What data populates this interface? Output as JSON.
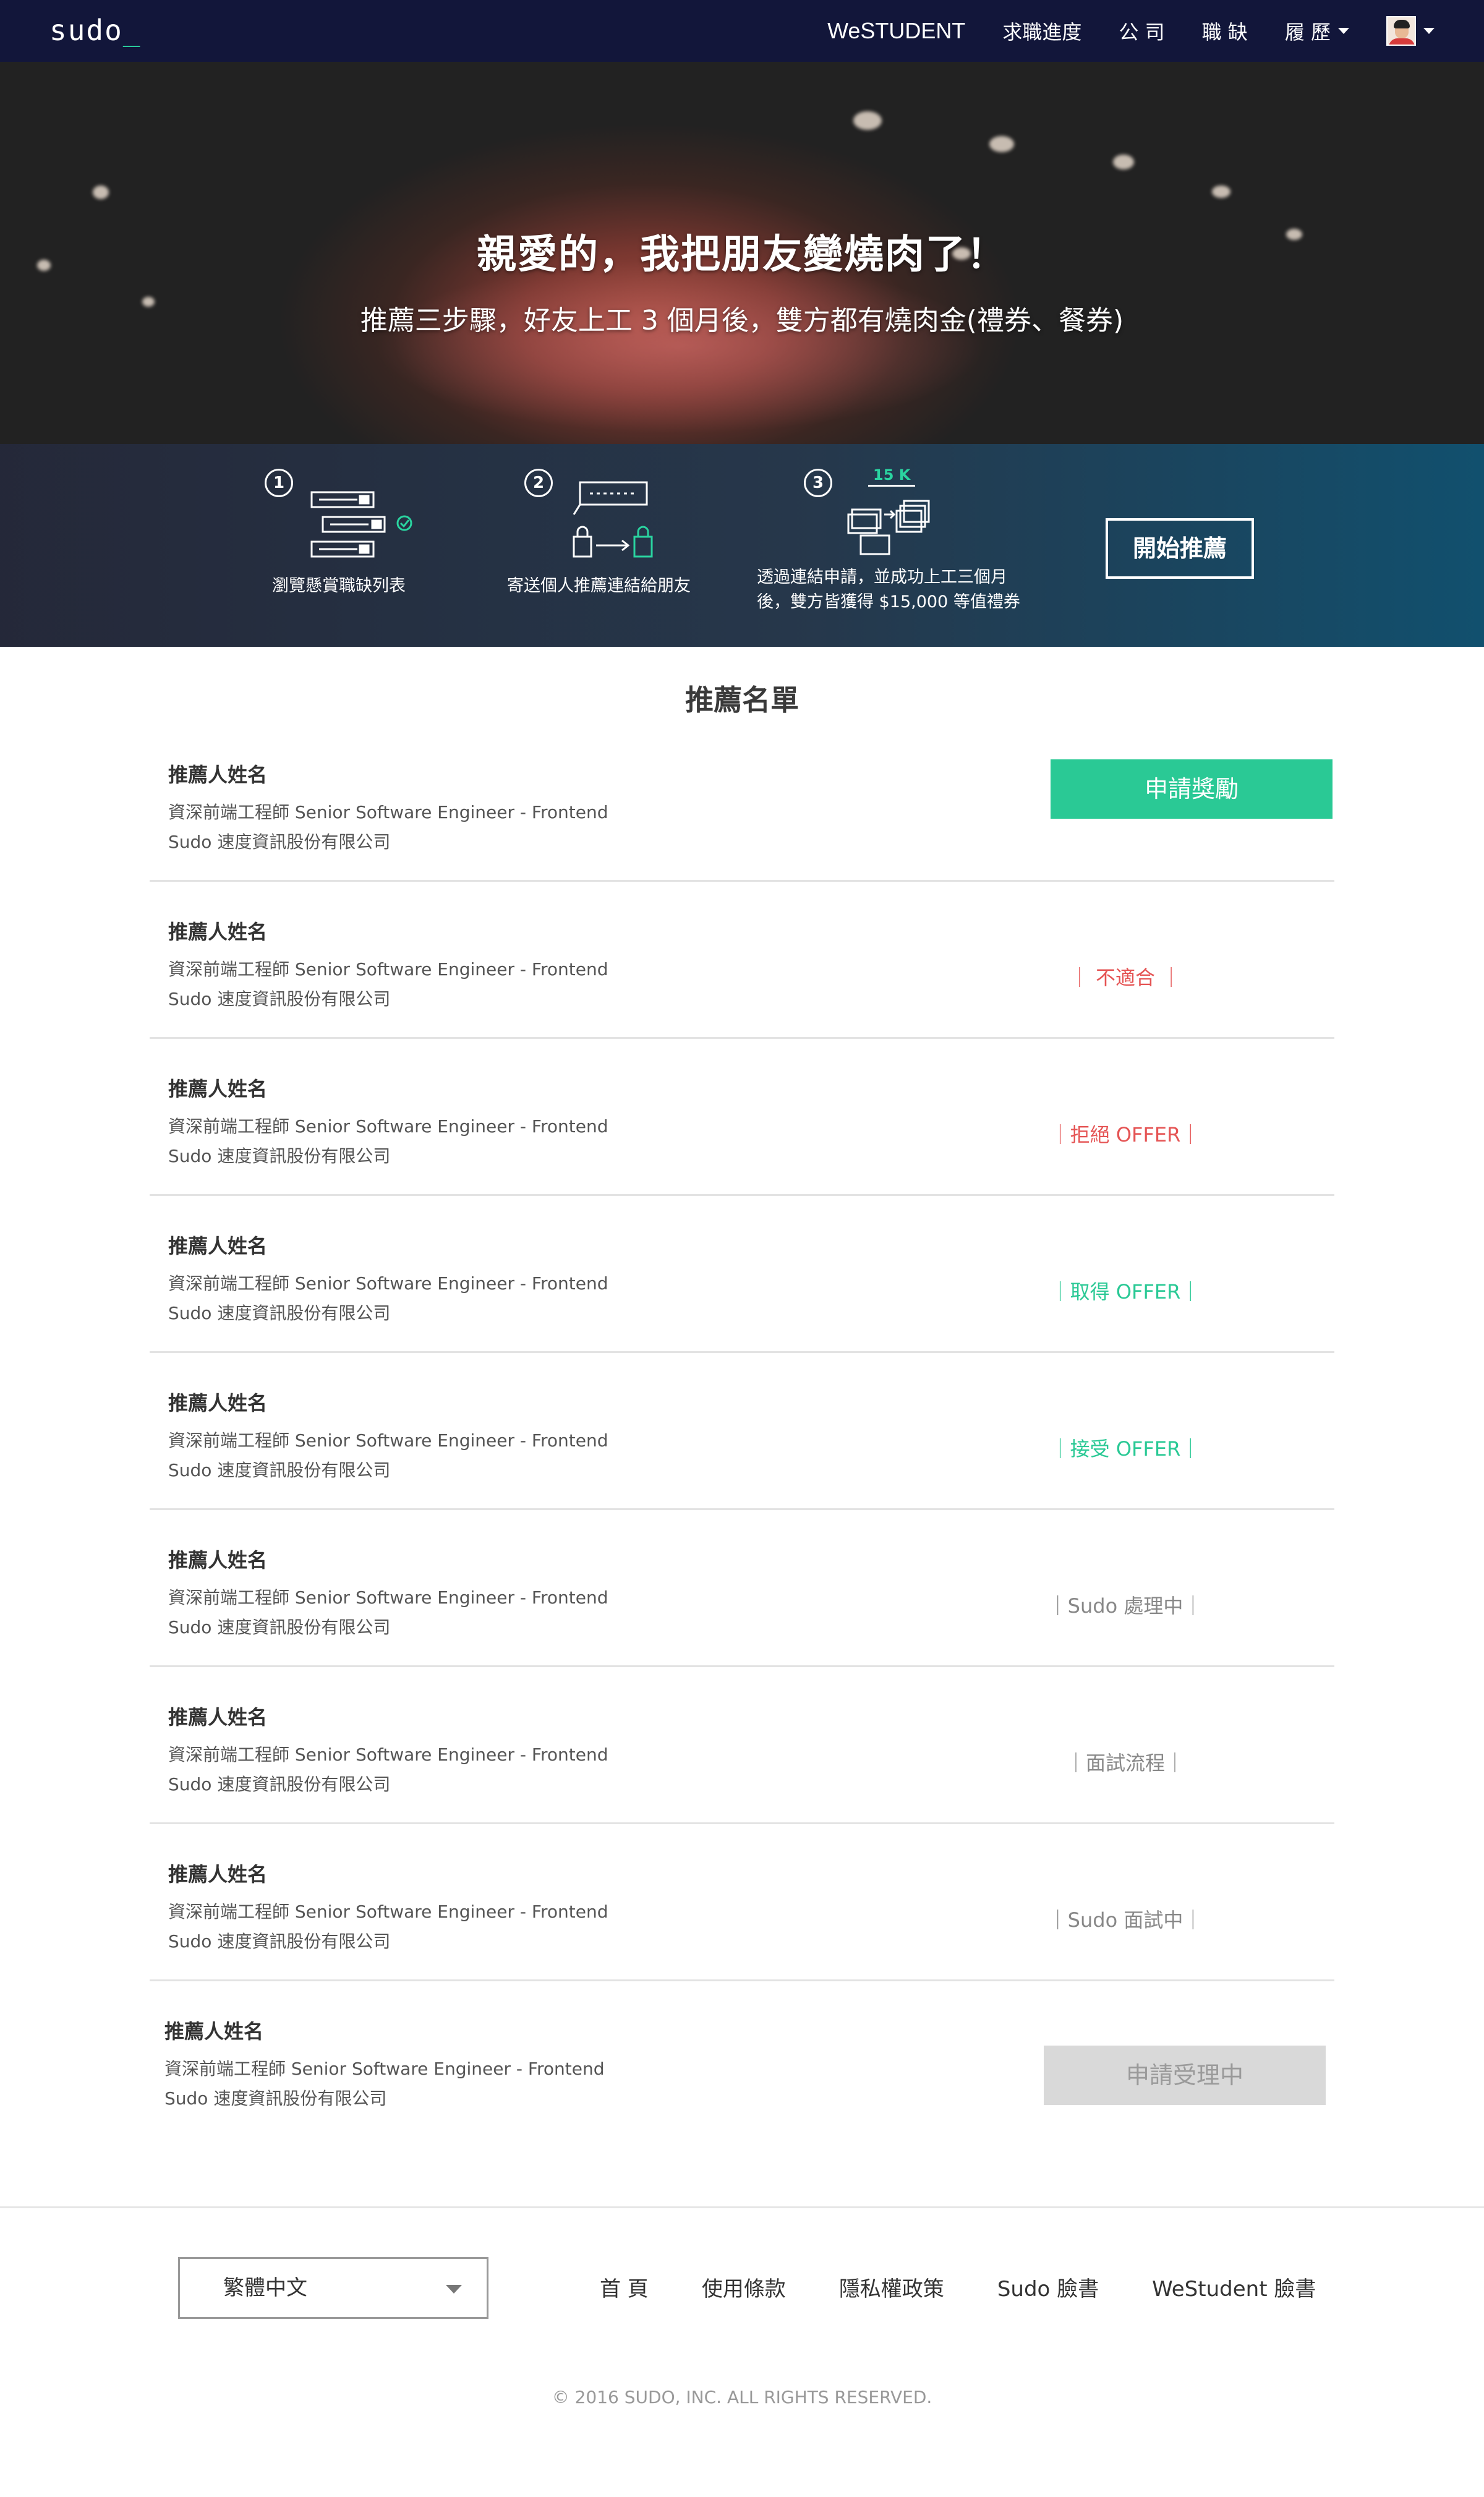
{
  "nav": {
    "logo": "sudo",
    "logo_cursor": "_",
    "brand": "WeSTUDENT",
    "links": [
      "求職進度",
      "公 司",
      "職 缺",
      "履 歷"
    ]
  },
  "hero": {
    "title": "親愛的，我把朋友變燒肉了！",
    "subtitle": "推薦三步驟，好友上工 3 個月後，雙方都有燒肉金(禮券、餐券)"
  },
  "steps": [
    {
      "num": "1",
      "label": "瀏覽懸賞職缺列表"
    },
    {
      "num": "2",
      "label": "寄送個人推薦連結給朋友"
    },
    {
      "num": "3",
      "label_line1": "透過連結申請，並成功上工三個月",
      "label_line2": "後，雙方皆獲得 $15,000 等值禮券",
      "badge": "15 K"
    }
  ],
  "cta_label": "開始推薦",
  "list_title": "推薦名單",
  "items": [
    {
      "name": "推薦人姓名",
      "job": "資深前端工程師 Senior Software Engineer - Frontend",
      "company": "Sudo 速度資訊股份有限公司",
      "action": "申請獎勵"
    },
    {
      "name": "推薦人姓名",
      "job": "資深前端工程師 Senior Software Engineer - Frontend",
      "company": "Sudo 速度資訊股份有限公司",
      "status": "｜ 不適合 ｜"
    },
    {
      "name": "推薦人姓名",
      "job": "資深前端工程師 Senior Software Engineer - Frontend",
      "company": "Sudo 速度資訊股份有限公司",
      "status": "｜拒絕 OFFER｜"
    },
    {
      "name": "推薦人姓名",
      "job": "資深前端工程師 Senior Software Engineer - Frontend",
      "company": "Sudo 速度資訊股份有限公司",
      "status": "｜取得 OFFER｜"
    },
    {
      "name": "推薦人姓名",
      "job": "資深前端工程師 Senior Software Engineer - Frontend",
      "company": "Sudo 速度資訊股份有限公司",
      "status": "｜接受 OFFER｜"
    },
    {
      "name": "推薦人姓名",
      "job": "資深前端工程師 Senior Software Engineer - Frontend",
      "company": "Sudo 速度資訊股份有限公司",
      "status": "｜Sudo 處理中｜"
    },
    {
      "name": "推薦人姓名",
      "job": "資深前端工程師 Senior Software Engineer - Frontend",
      "company": "Sudo 速度資訊股份有限公司",
      "status": "｜面試流程｜"
    },
    {
      "name": "推薦人姓名",
      "job": "資深前端工程師 Senior Software Engineer - Frontend",
      "company": "Sudo 速度資訊股份有限公司",
      "status": "｜Sudo 面試中｜"
    },
    {
      "name": "推薦人姓名",
      "job": "資深前端工程師 Senior Software Engineer - Frontend",
      "company": "Sudo 速度資訊股份有限公司",
      "action": "申請受理中"
    }
  ],
  "colors": {
    "nav_bg": "#12163a",
    "accent_green": "#2ac995",
    "status_red": "#e55454",
    "status_grey": "#888888"
  },
  "footer": {
    "language": "繁體中文",
    "links": [
      "首 頁",
      "使用條款",
      "隱私權政策",
      "Sudo 臉書",
      "WeStudent 臉書"
    ],
    "copyright": "© 2016 SUDO, INC. ALL RIGHTS RESERVED."
  }
}
